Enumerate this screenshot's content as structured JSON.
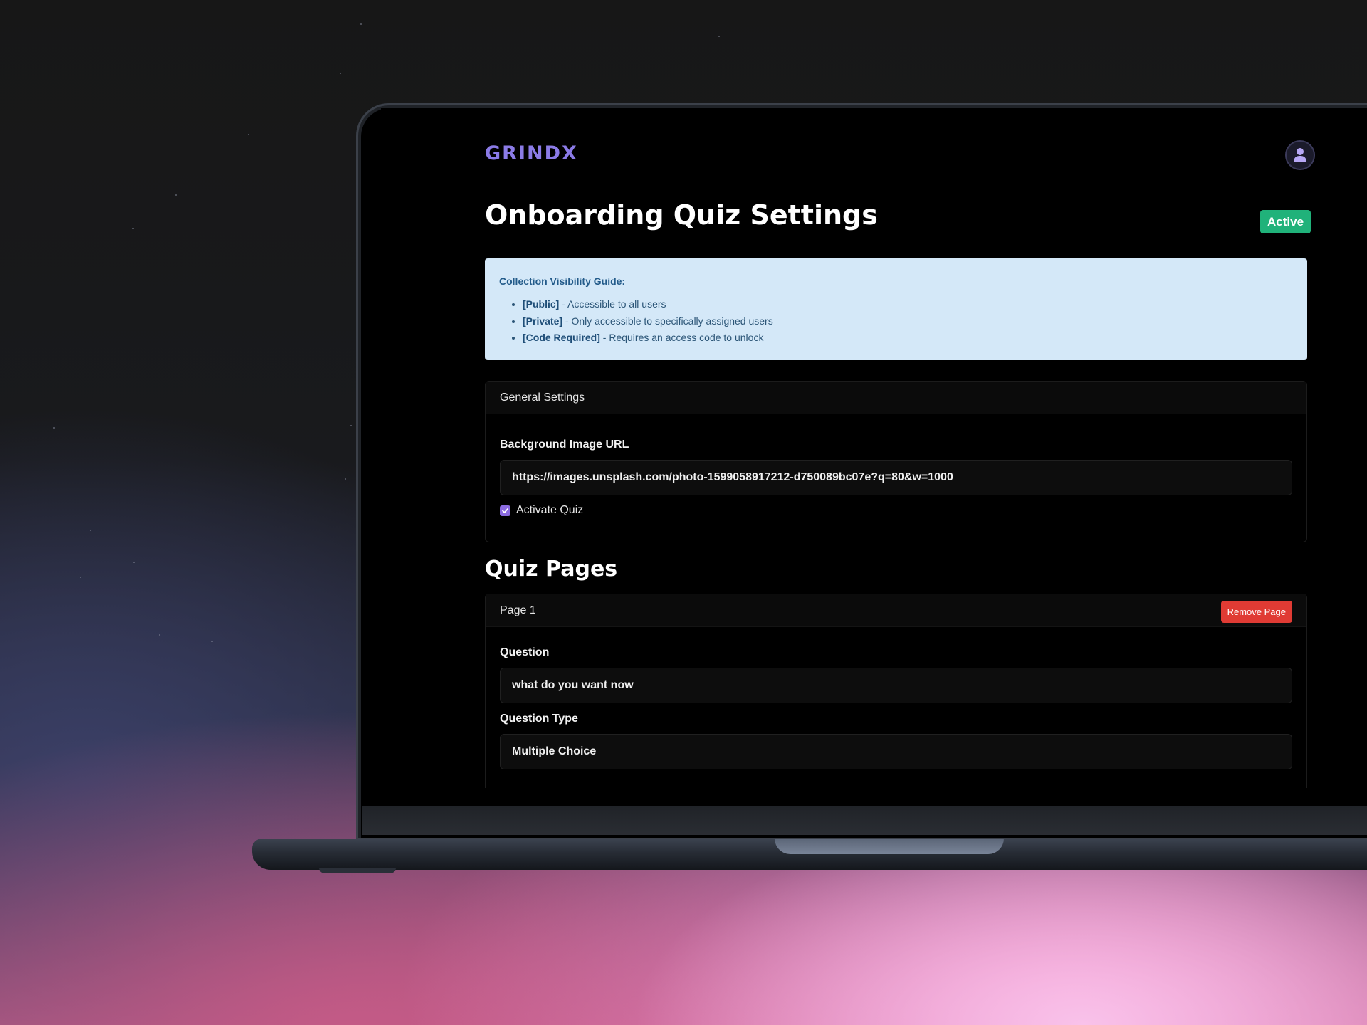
{
  "app": {
    "logo": "GRINDX"
  },
  "header": {
    "title": "Onboarding Quiz Settings",
    "status": "Active"
  },
  "guide": {
    "title": "Collection Visibility Guide:",
    "items": [
      {
        "tag": "[Public]",
        "text": " - Accessible to all users"
      },
      {
        "tag": "[Private]",
        "text": " - Only accessible to specifically assigned users"
      },
      {
        "tag": "[Code Required]",
        "text": " - Requires an access code to unlock"
      }
    ]
  },
  "general": {
    "header": "General Settings",
    "bg_label": "Background Image URL",
    "bg_value": "https://images.unsplash.com/photo-1599058917212-d750089bc07e?q=80&w=1000",
    "activate_label": "Activate Quiz",
    "activate_checked": true
  },
  "quiz_pages": {
    "title": "Quiz Pages",
    "pages": [
      {
        "header": "Page 1",
        "remove_label": "Remove Page",
        "question_label": "Question",
        "question_value": "what do you want now",
        "type_label": "Question Type",
        "type_value": "Multiple Choice"
      }
    ]
  },
  "colors": {
    "accent": "#8b7be6",
    "status_active": "#20b27a",
    "danger": "#e03b34",
    "info_bg": "#d4e8f8"
  },
  "icons": {
    "avatar": "user-icon",
    "checkbox": "checkmark-icon"
  }
}
